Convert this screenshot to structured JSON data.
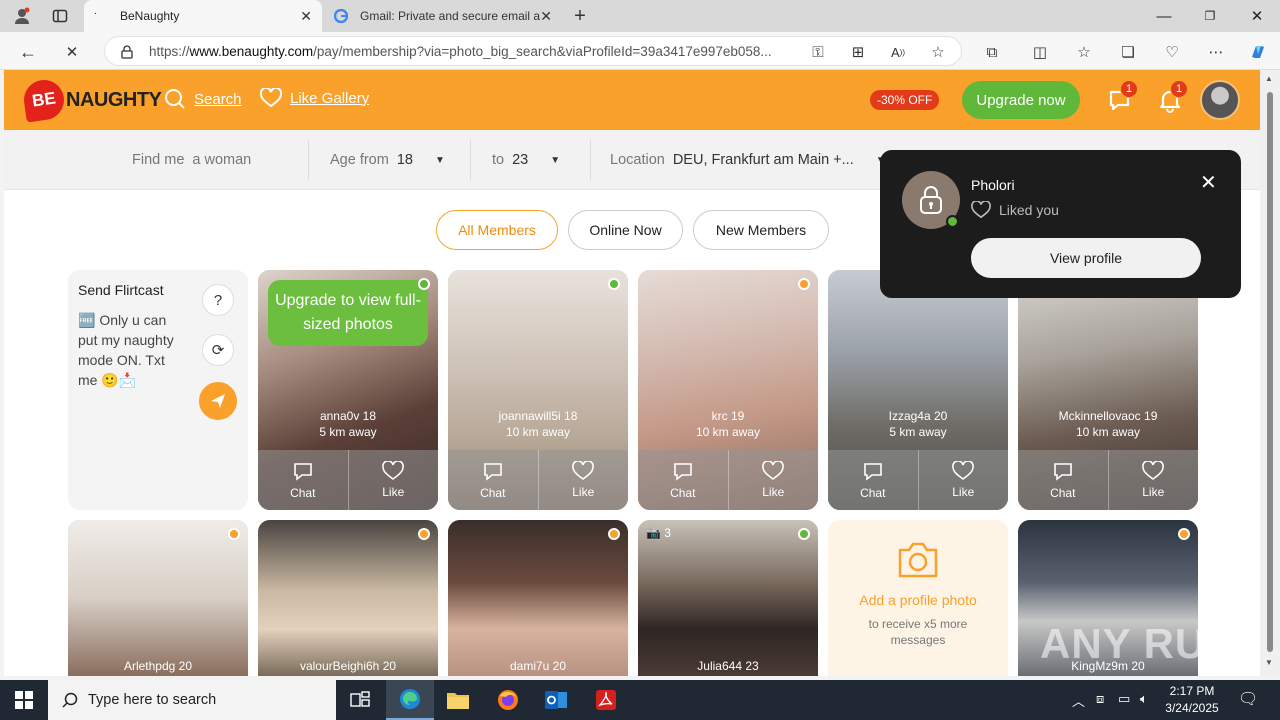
{
  "browser": {
    "tabs": [
      {
        "title": "BeNaughty",
        "active": true
      },
      {
        "title": "Gmail: Private and secure email a",
        "active": false
      }
    ],
    "url_prefix": "https://",
    "url_domain": "www.benaughty.com",
    "url_path": "/pay/membership?via=photo_big_search&viaProfileId=39a3417e997eb058..."
  },
  "header": {
    "logo_be": "BE",
    "logo_text": "NAUGHTY",
    "nav": [
      {
        "label": "Search"
      },
      {
        "label": "Like Gallery"
      }
    ],
    "discount": "-30% OFF",
    "upgrade_label": "Upgrade now",
    "chat_badge": "1",
    "notif_badge": "1"
  },
  "filters": {
    "find_label": "Find me",
    "find_value": "a woman",
    "age_from_label": "Age from",
    "age_from_value": "18",
    "age_to_label": "to",
    "age_to_value": "23",
    "location_label": "Location",
    "location_value": "DEU, Frankfurt am Main +..."
  },
  "tabs": [
    {
      "label": "All Members",
      "active": true
    },
    {
      "label": "Online Now",
      "active": false
    },
    {
      "label": "New Members",
      "active": false
    }
  ],
  "flirtcast": {
    "title": "Send Flirtcast",
    "message": "🆓 Only u can put my naughty mode ON. Txt me 🙂📩"
  },
  "cards_row1": [
    {
      "name": "anna0v",
      "age": "18",
      "distance": "5 km away",
      "status": "green",
      "upsell": "Upgrade to view full-sized photos"
    },
    {
      "name": "joannawill5i",
      "age": "18",
      "distance": "10 km away",
      "status": "green"
    },
    {
      "name": "krc",
      "age": "19",
      "distance": "10 km away",
      "status": "orange"
    },
    {
      "name": "Izzag4a",
      "age": "20",
      "distance": "5 km away",
      "status": "green"
    },
    {
      "name": "Mckinnellovaoc",
      "age": "19",
      "distance": "10 km away",
      "status": "orange"
    }
  ],
  "cards_row2": [
    {
      "name": "Arlethpdg",
      "age": "20",
      "status": "orange"
    },
    {
      "name": "valourBeighi6h",
      "age": "20",
      "status": "orange"
    },
    {
      "name": "dami7u",
      "age": "20",
      "status": "orange"
    },
    {
      "name": "Julia644",
      "age": "23",
      "status": "green",
      "photos": "3"
    },
    {
      "name": "KingMz9m",
      "age": "20",
      "status": "orange"
    }
  ],
  "card_actions": {
    "chat": "Chat",
    "like": "Like"
  },
  "add_photo": {
    "title": "Add a profile photo",
    "subtitle": "to receive x5 more messages"
  },
  "popup": {
    "name": "Pholori",
    "action": "Liked you",
    "button": "View profile"
  },
  "watermark": "ANY RUN",
  "taskbar": {
    "search_placeholder": "Type here to search",
    "time": "2:17 PM",
    "date": "3/24/2025"
  },
  "colors": {
    "brand": "#f9a12a",
    "upgrade": "#5fb83a",
    "alert": "#e33a1a"
  }
}
